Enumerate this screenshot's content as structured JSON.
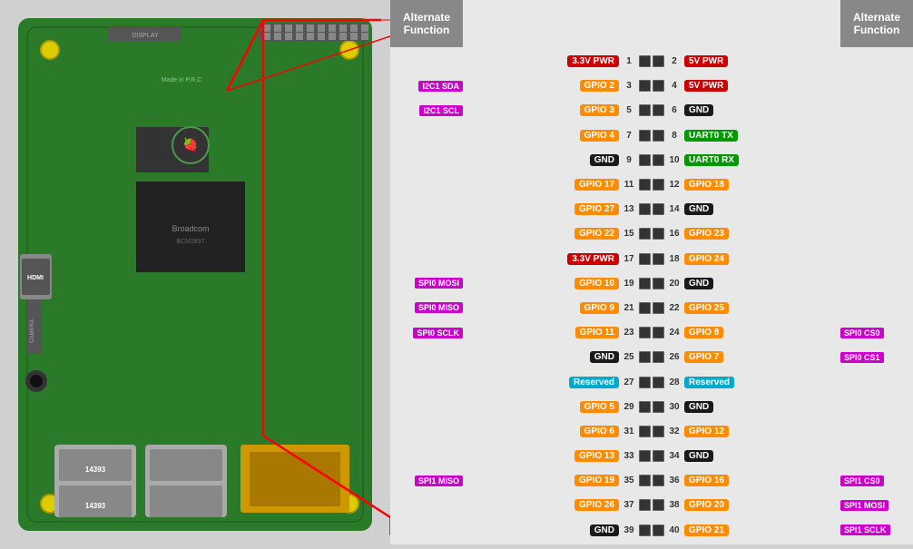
{
  "header": {
    "alt_func_left": "Alternate\nFunction",
    "alt_func_right": "Alternate\nFunction"
  },
  "pins": [
    {
      "left_alt": "",
      "left_name": "3.3V PWR",
      "left_color": "c-red",
      "left_num": "1",
      "right_num": "2",
      "right_name": "5V PWR",
      "right_color": "c-red",
      "right_alt": ""
    },
    {
      "left_alt": "I2C1 SDA",
      "left_name": "GPIO 2",
      "left_color": "c-orange",
      "left_num": "3",
      "right_num": "4",
      "right_name": "5V PWR",
      "right_color": "c-red",
      "right_alt": ""
    },
    {
      "left_alt": "I2C1 SCL",
      "left_name": "GPIO 3",
      "left_color": "c-orange",
      "left_num": "5",
      "right_num": "6",
      "right_name": "GND",
      "right_color": "c-black",
      "right_alt": ""
    },
    {
      "left_alt": "",
      "left_name": "GPIO 4",
      "left_color": "c-orange",
      "left_num": "7",
      "right_num": "8",
      "right_name": "UART0 TX",
      "right_color": "c-green",
      "right_alt": ""
    },
    {
      "left_alt": "",
      "left_name": "GND",
      "left_color": "c-black",
      "left_num": "9",
      "right_num": "10",
      "right_name": "UART0 RX",
      "right_color": "c-green",
      "right_alt": ""
    },
    {
      "left_alt": "",
      "left_name": "GPIO 17",
      "left_color": "c-orange",
      "left_num": "11",
      "right_num": "12",
      "right_name": "GPIO 18",
      "right_color": "c-orange",
      "right_alt": ""
    },
    {
      "left_alt": "",
      "left_name": "GPIO 27",
      "left_color": "c-orange",
      "left_num": "13",
      "right_num": "14",
      "right_name": "GND",
      "right_color": "c-black",
      "right_alt": ""
    },
    {
      "left_alt": "",
      "left_name": "GPIO 22",
      "left_color": "c-orange",
      "left_num": "15",
      "right_num": "16",
      "right_name": "GPIO 23",
      "right_color": "c-orange",
      "right_alt": ""
    },
    {
      "left_alt": "",
      "left_name": "3.3V PWR",
      "left_color": "c-red",
      "left_num": "17",
      "right_num": "18",
      "right_name": "GPIO 24",
      "right_color": "c-orange",
      "right_alt": ""
    },
    {
      "left_alt": "SPI0 MOSI",
      "left_name": "GPIO 10",
      "left_color": "c-orange",
      "left_num": "19",
      "right_num": "20",
      "right_name": "GND",
      "right_color": "c-black",
      "right_alt": ""
    },
    {
      "left_alt": "SPI0 MISO",
      "left_name": "GPIO 9",
      "left_color": "c-orange",
      "left_num": "21",
      "right_num": "22",
      "right_name": "GPIO 25",
      "right_color": "c-orange",
      "right_alt": ""
    },
    {
      "left_alt": "SPI0 SCLK",
      "left_name": "GPIO 11",
      "left_color": "c-orange",
      "left_num": "23",
      "right_num": "24",
      "right_name": "GPIO 8",
      "right_color": "c-orange",
      "right_alt": "SPI0 CS0"
    },
    {
      "left_alt": "",
      "left_name": "GND",
      "left_color": "c-black",
      "left_num": "25",
      "right_num": "26",
      "right_name": "GPIO 7",
      "right_color": "c-orange",
      "right_alt": "SPI0 CS1"
    },
    {
      "left_alt": "",
      "left_name": "Reserved",
      "left_color": "c-cyan",
      "left_num": "27",
      "right_num": "28",
      "right_name": "Reserved",
      "right_color": "c-cyan",
      "right_alt": ""
    },
    {
      "left_alt": "",
      "left_name": "GPIO 5",
      "left_color": "c-orange",
      "left_num": "29",
      "right_num": "30",
      "right_name": "GND",
      "right_color": "c-black",
      "right_alt": ""
    },
    {
      "left_alt": "",
      "left_name": "GPIO 6",
      "left_color": "c-orange",
      "left_num": "31",
      "right_num": "32",
      "right_name": "GPIO 12",
      "right_color": "c-orange",
      "right_alt": ""
    },
    {
      "left_alt": "",
      "left_name": "GPIO 13",
      "left_color": "c-orange",
      "left_num": "33",
      "right_num": "34",
      "right_name": "GND",
      "right_color": "c-black",
      "right_alt": ""
    },
    {
      "left_alt": "SPI1 MISO",
      "left_name": "GPIO 19",
      "left_color": "c-orange",
      "left_num": "35",
      "right_num": "36",
      "right_name": "GPIO 16",
      "right_color": "c-orange",
      "right_alt": "SPI1 CS0"
    },
    {
      "left_alt": "",
      "left_name": "GPIO 26",
      "left_color": "c-orange",
      "left_num": "37",
      "right_num": "38",
      "right_name": "GPIO 20",
      "right_color": "c-orange",
      "right_alt": "SPI1 MOSI"
    },
    {
      "left_alt": "",
      "left_name": "GND",
      "left_color": "c-black",
      "left_num": "39",
      "right_num": "40",
      "right_name": "GPIO 21",
      "right_color": "c-orange",
      "right_alt": "SPI1 SCLK"
    }
  ]
}
